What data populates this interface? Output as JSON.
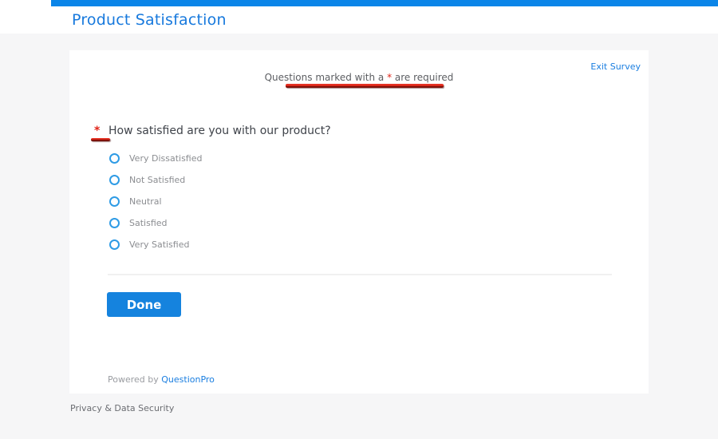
{
  "colors": {
    "top_bar_blue": "#0b85e8",
    "title_blue": "#1779dd",
    "link_blue": "#1a7ee0",
    "button_blue": "#1583de",
    "radio_outline_blue": "#2e9be5",
    "annotation_red": "#dd2418",
    "annotation_red_shadow": "#7d120b",
    "page_background": "#f6f6f7",
    "card_background": "#ffffff"
  },
  "header": {
    "title": "Product Satisfaction"
  },
  "survey": {
    "exit_link_label": "Exit Survey",
    "required_note": {
      "prefix": "Questions marked with a ",
      "asterisk": "*",
      "suffix": " are required"
    },
    "question": {
      "required_marker": "*",
      "text": "How satisfied are you with our product?",
      "options": [
        "Very Dissatisfied",
        "Not Satisfied",
        "Neutral",
        "Satisfied",
        "Very Satisfied"
      ]
    },
    "done_button_label": "Done",
    "powered_by": {
      "prefix": "Powered by ",
      "brand": "QuestionPro"
    }
  },
  "page_footer": {
    "privacy_label": "Privacy & Data Security"
  }
}
